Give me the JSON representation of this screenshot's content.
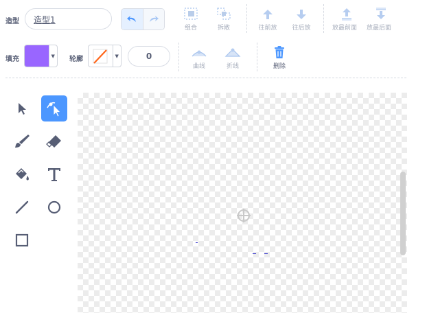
{
  "costume": {
    "label": "造型",
    "name": "造型1"
  },
  "toolbar_top": {
    "undo_label": "undo",
    "redo_label": "redo",
    "group": "组合",
    "ungroup": "拆散",
    "forward": "往前放",
    "backward": "往后放",
    "front": "放最前面",
    "back": "放最后面"
  },
  "toolbar_second": {
    "fill_label": "填充",
    "fill_color": "#9966ff",
    "outline_label": "轮廓",
    "outline_width": "0",
    "curve": "曲线",
    "polyline": "折线",
    "delete": "删除"
  },
  "tools": {
    "select": "select-tool",
    "reshape": "reshape-tool",
    "brush": "brush-tool",
    "eraser": "eraser-tool",
    "fill": "fill-tool",
    "text": "text-tool",
    "line": "line-tool",
    "circle": "circle-tool",
    "rectangle": "rectangle-tool",
    "selected": "reshape"
  },
  "colors": {
    "accent": "#4c97ff",
    "text": "#575e75",
    "disabled": "#a8afbd",
    "delete": "#4c97ff"
  }
}
